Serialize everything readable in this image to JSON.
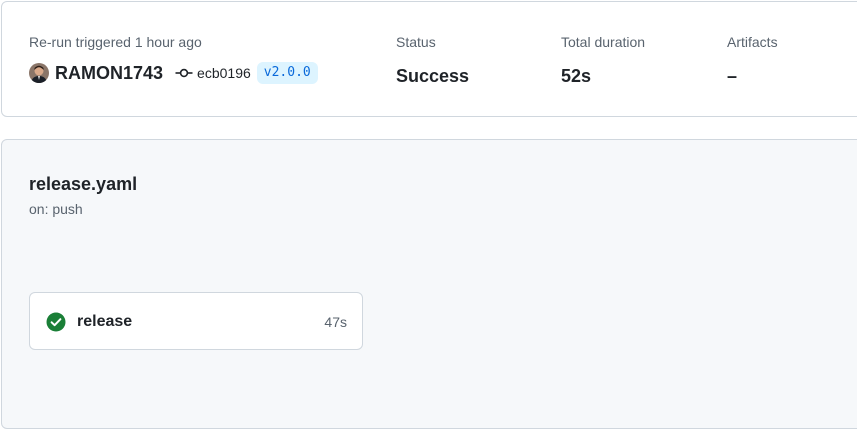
{
  "summary": {
    "trigger_label": "Re-run triggered 1 hour ago",
    "actor": "RAMON1743",
    "commit_sha": "ecb0196",
    "tag": "v2.0.0",
    "status_label": "Status",
    "status_value": "Success",
    "duration_label": "Total duration",
    "duration_value": "52s",
    "artifacts_label": "Artifacts",
    "artifacts_value": "–"
  },
  "workflow": {
    "name": "release.yaml",
    "trigger": "on: push",
    "jobs": [
      {
        "name": "release",
        "duration": "47s",
        "status": "success"
      }
    ]
  },
  "colors": {
    "success": "#1a7f37",
    "tag_text": "#0969da",
    "tag_bg": "#ddf4ff"
  },
  "icons": [
    "avatar",
    "git-commit-icon",
    "check-circle-icon"
  ]
}
